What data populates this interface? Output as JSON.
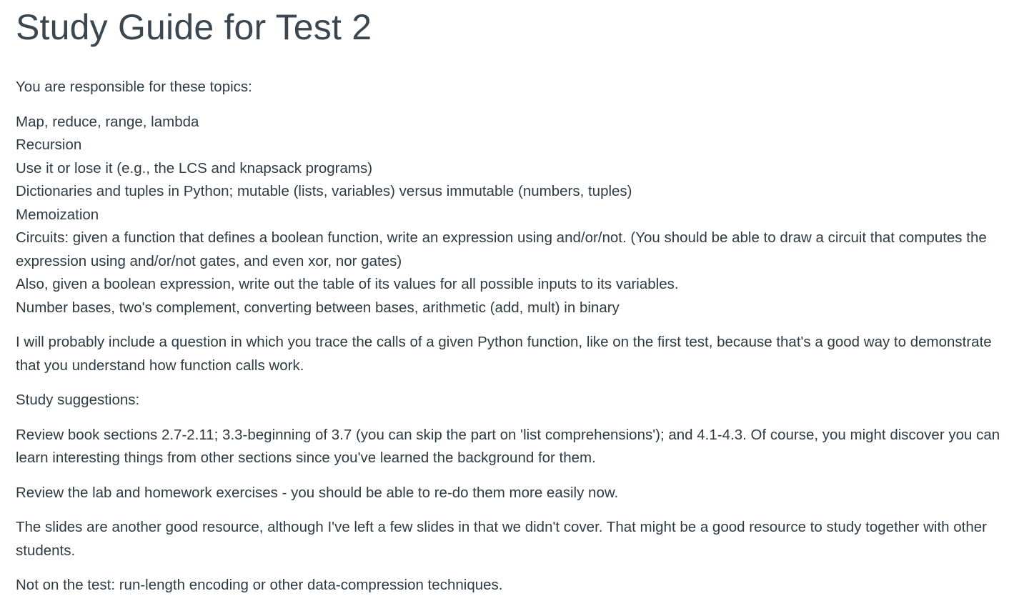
{
  "title": "Study Guide for Test 2",
  "intro": "You are responsible for these topics:",
  "topics": [
    "Map, reduce, range, lambda",
    "Recursion",
    "Use it or lose it (e.g., the LCS and knapsack programs)",
    "Dictionaries and tuples in Python; mutable (lists, variables) versus immutable (numbers, tuples)",
    "Memoization",
    "Circuits: given a function that defines a boolean function, write an expression using and/or/not.  (You should be able to draw a circuit that computes the expression using and/or/not gates, and even xor, nor gates)",
    "Also, given a boolean expression, write out the table of its values for all possible inputs to its variables.",
    "Number bases, two's complement, converting between bases, arithmetic (add, mult) in binary"
  ],
  "trace_note": "I will probably include a question in which you trace the calls of a given Python function, like on the first test, because that's a good way to demonstrate that you understand how function calls work.",
  "suggestions_heading": "Study suggestions:",
  "suggestions": [
    "Review book sections 2.7-2.11; 3.3-beginning of 3.7 (you can skip the part on 'list comprehensions'); and 4.1-4.3. Of course, you might discover you can learn interesting things from other sections since you've learned the background for them.",
    "Review the lab and homework exercises - you should be able to re-do them more easily now.",
    "The slides are another good resource, although I've left a few slides in that we didn't cover. That might be a good resource to study together with other students.",
    "Not on the test: run-length encoding or other data-compression techniques."
  ]
}
